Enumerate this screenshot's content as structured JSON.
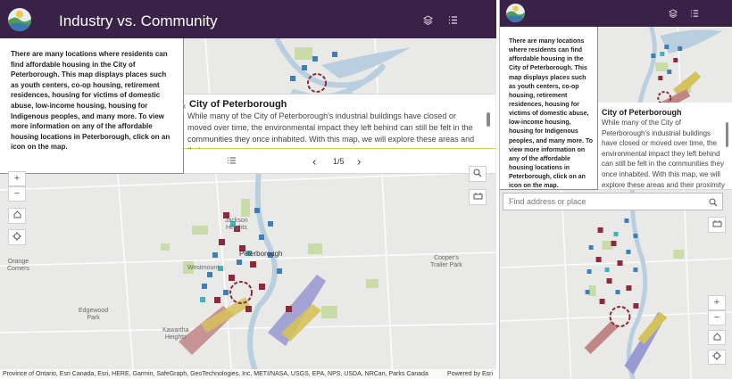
{
  "desktop": {
    "header": {
      "title": "Industry vs. Community",
      "layers_icon": "layers-icon",
      "list_icon": "list-icon"
    },
    "info_panel": {
      "text": "There are many locations where residents can find affordable housing in the City of Peterborough. This map displays places such as youth centers, co-op housing, retirement residences, housing for victims of domestic abuse, low-income housing, housing for Indigenous peoples, and many more. To view more information on any of the affordable housing locations in Peterborough, click on an icon on the map."
    },
    "story": {
      "heading": "City of Peterborough",
      "body": "While many of the City of Peterborough's industrial buildings have closed or moved over time, the environmental impact they left behind can still be felt in the communities they once inhabited. With this map, we will explore these areas and their"
    },
    "pager": {
      "page": "1/5",
      "prev_icon": "chevron-left-icon",
      "next_icon": "chevron-right-icon",
      "menu_icon": "list-icon"
    },
    "controls": {
      "zoom_in": "+",
      "zoom_out": "−"
    },
    "places": {
      "orange_corners": "Orange\nCorners",
      "westmount": "Westmount",
      "edgewood": "Edgewood\nPark",
      "kawartha": "Kawartha\nHeights",
      "coopers": "Cooper's\nTrailer Park",
      "peterborough": "Peterborough",
      "jackson": "Jackson\nHeights"
    },
    "attribution": "Province of Ontario, Esri Canada, Esri, HERE, Garmin, SafeGraph, GeoTechnologies, Inc, METI/NASA, USGS, EPA, NPS, USDA, NRCan, Parks Canada",
    "powered_by": "Powered by Esri"
  },
  "mobile": {
    "info_panel": {
      "text": "There are many locations where residents can find affordable housing in the City of Peterborough. This map displays places such as youth centers, co-op housing, retirement residences, housing for victims of domestic abuse, low-income housing, housing for Indigenous peoples, and many more. To view more information on any of the affordable housing locations in Peterborough, click on an icon on the map."
    },
    "story": {
      "heading": "City of Peterborough",
      "body": "While many of the City of Peterborough's industrial buildings have closed or moved over time, the environmental impact they left behind can still be felt in the communities they once inhabited. With this map, we will explore these areas and their proximity to affordable housing locations."
    },
    "search": {
      "placeholder": "Find address or place"
    },
    "controls": {
      "zoom_in": "+",
      "zoom_out": "−"
    }
  },
  "colors": {
    "header": "#3a2147",
    "water": "#b9cfe0",
    "park": "#c9dca8",
    "industrial": "#8b2a3c",
    "housing": "#3f7fb8",
    "zone_purple": "#9a9ad2",
    "zone_yellow": "#d6c25a",
    "zone_rose": "#c08585"
  }
}
